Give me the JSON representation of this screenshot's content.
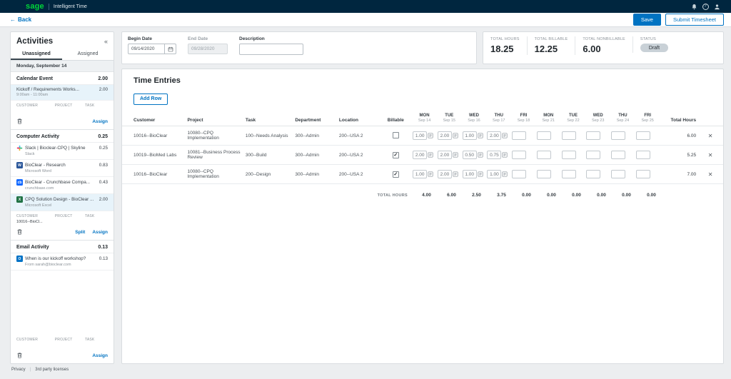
{
  "topbar": {
    "brand": "sage",
    "product": "Intelligent Time",
    "help_glyph": "?"
  },
  "actionbar": {
    "back_arrow": "←",
    "back_label": "Back",
    "save_label": "Save",
    "submit_label": "Submit Timesheet"
  },
  "sidebar": {
    "title": "Activities",
    "collapse_glyph": "«",
    "tabs": {
      "unassigned": "Unassigned",
      "assigned": "Assigned"
    },
    "date_header": "Monday, September 14",
    "field_headers": [
      "CUSTOMER",
      "PROJECT",
      "TASK"
    ],
    "groups": [
      {
        "name": "Calendar Event",
        "total": "2.00",
        "items": [
          {
            "title": "Kickoff / Requirements Works...",
            "hours": "2.00",
            "subtitle": "9:00am - 11:00am",
            "selected": true
          }
        ],
        "fields": {
          "customer": "",
          "project": "",
          "task": ""
        },
        "actions": {
          "assign": "Assign"
        }
      },
      {
        "name": "Computer Activity",
        "total": "0.25",
        "items": [
          {
            "icon": "slack-icon",
            "title": "Slack | Bioclear-CPQ | Skyline",
            "hours": "0.25",
            "subtitle": "Slack",
            "selected": false
          },
          {
            "icon": "word-icon",
            "icon_label": "W",
            "title": "BioClear - Research",
            "hours": "0.83",
            "subtitle": "Microsoft Word",
            "selected": false
          },
          {
            "icon": "crunchbase-icon",
            "icon_label": "cb",
            "title": "BioClear - Crunchbase Compa...",
            "hours": "0.43",
            "subtitle": "crunchbase.com",
            "selected": false
          },
          {
            "icon": "excel-icon",
            "icon_label": "X",
            "title": "CPQ Solution Design - BioClear ...",
            "hours": "2.00",
            "subtitle": "Microsoft Excel",
            "selected": true
          }
        ],
        "fields": {
          "customer": "10016--BioCl...",
          "project": "",
          "task": ""
        },
        "actions": {
          "split": "Split",
          "assign": "Assign"
        }
      },
      {
        "name": "Email Activity",
        "total": "0.13",
        "items": [
          {
            "icon": "outlook-icon",
            "icon_label": "O",
            "title": "When is our kickoff workshop?",
            "hours": "0.13",
            "subtitle": "From sarah@bioclear.com",
            "selected": false
          }
        ],
        "fields": {
          "customer": "",
          "project": "",
          "task": ""
        },
        "actions": {
          "assign": "Assign"
        }
      }
    ]
  },
  "filters": {
    "begin_date": {
      "label": "Begin Date",
      "value": "09/14/2020"
    },
    "end_date": {
      "label": "End Date",
      "value": "09/28/2020"
    },
    "description": {
      "label": "Description",
      "value": ""
    }
  },
  "summary": {
    "stats": [
      {
        "label": "TOTAL HOURS",
        "value": "18.25"
      },
      {
        "label": "TOTAL BILLABLE",
        "value": "12.25"
      },
      {
        "label": "TOTAL NONBILLABLE",
        "value": "6.00"
      }
    ],
    "status_label": "STATUS",
    "status_value": "Draft"
  },
  "entries": {
    "title": "Time Entries",
    "add_row_label": "Add Row",
    "columns": [
      "Customer",
      "Project",
      "Task",
      "Department",
      "Location",
      "Billable"
    ],
    "total_hours_column": "Total Hours",
    "check_glyph": "✓",
    "delete_glyph": "✕",
    "day_columns": [
      {
        "day": "MON",
        "date": "Sep 14"
      },
      {
        "day": "TUE",
        "date": "Sep 15"
      },
      {
        "day": "WED",
        "date": "Sep 16"
      },
      {
        "day": "THU",
        "date": "Sep 17"
      },
      {
        "day": "FRI",
        "date": "Sep 18"
      },
      {
        "day": "MON",
        "date": "Sep 21"
      },
      {
        "day": "TUE",
        "date": "Sep 22"
      },
      {
        "day": "WED",
        "date": "Sep 23"
      },
      {
        "day": "THU",
        "date": "Sep 24"
      },
      {
        "day": "FRI",
        "date": "Sep 25"
      }
    ],
    "rows": [
      {
        "customer": "10016--BioClear",
        "project": "10080--CPQ Implementation",
        "task": "100--Needs Analysis",
        "department": "300--Admin",
        "location": "200--USA 2",
        "billable": false,
        "days": [
          "1.00",
          "2.00",
          "1.00",
          "2.00",
          "",
          "",
          "",
          "",
          "",
          ""
        ],
        "total": "6.00"
      },
      {
        "customer": "10019--BioMed Labs",
        "project": "10081--Business Process Review",
        "task": "300--Build",
        "department": "300--Admin",
        "location": "200--USA 2",
        "billable": true,
        "days": [
          "2.00",
          "2.00",
          "0.50",
          "0.75",
          "",
          "",
          "",
          "",
          "",
          ""
        ],
        "total": "5.25"
      },
      {
        "customer": "10016--BioClear",
        "project": "10080--CPQ Implementation",
        "task": "200--Design",
        "department": "300--Admin",
        "location": "200--USA 2",
        "billable": true,
        "days": [
          "1.00",
          "2.00",
          "1.00",
          "1.00",
          "",
          "",
          "",
          "",
          "",
          ""
        ],
        "total": "7.00"
      }
    ],
    "totals": {
      "label": "TOTAL HOURS",
      "values": [
        "4.00",
        "6.00",
        "2.50",
        "3.75",
        "0.00",
        "0.00",
        "0.00",
        "0.00",
        "0.00",
        "0.00"
      ]
    }
  },
  "footer": {
    "privacy": "Privacy",
    "separator": "|",
    "licenses": "3rd party licenses"
  },
  "colors": {
    "accent_blue": "#0073C2",
    "brand_green": "#00D639",
    "topbar_navy": "#00263F",
    "status_badge_bg": "#C9D1D7",
    "selected_row_bg": "#E7F3FA"
  }
}
